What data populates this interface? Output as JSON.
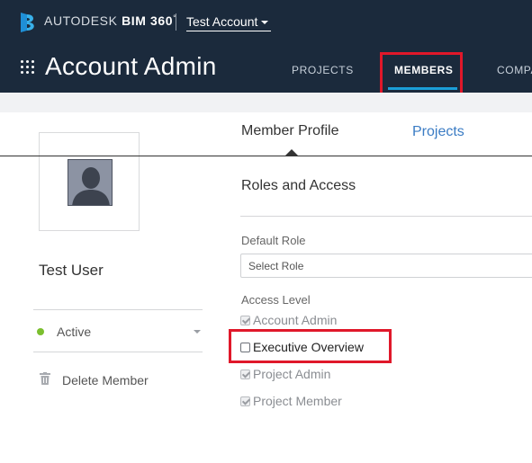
{
  "brand": {
    "name_prefix": "AUTODESK",
    "name_product": "BIM 360",
    "trademark": "°"
  },
  "account": {
    "name": "Test Account"
  },
  "header": {
    "title": "Account Admin",
    "nav": [
      {
        "label": "PROJECTS"
      },
      {
        "label": "MEMBERS"
      },
      {
        "label": "COMPA"
      }
    ]
  },
  "profile": {
    "user_name": "Test User",
    "status": "Active",
    "delete_label": "Delete Member"
  },
  "tabs": [
    {
      "label": "Member Profile"
    },
    {
      "label": "Projects"
    }
  ],
  "roles": {
    "section_title": "Roles and Access",
    "default_role_label": "Default Role",
    "default_role_placeholder": "Select Role",
    "access_level_label": "Access Level",
    "access_levels": [
      {
        "label": "Account Admin",
        "checked": true,
        "enabled": false
      },
      {
        "label": "Executive Overview",
        "checked": false,
        "enabled": true
      },
      {
        "label": "Project Admin",
        "checked": true,
        "enabled": false
      },
      {
        "label": "Project Member",
        "checked": true,
        "enabled": false
      }
    ]
  },
  "colors": {
    "header_bg": "#1b2a3c",
    "accent": "#1b9ed8",
    "highlight": "#e0182a",
    "status_active": "#7bbf2f",
    "link": "#3b7cc4"
  }
}
